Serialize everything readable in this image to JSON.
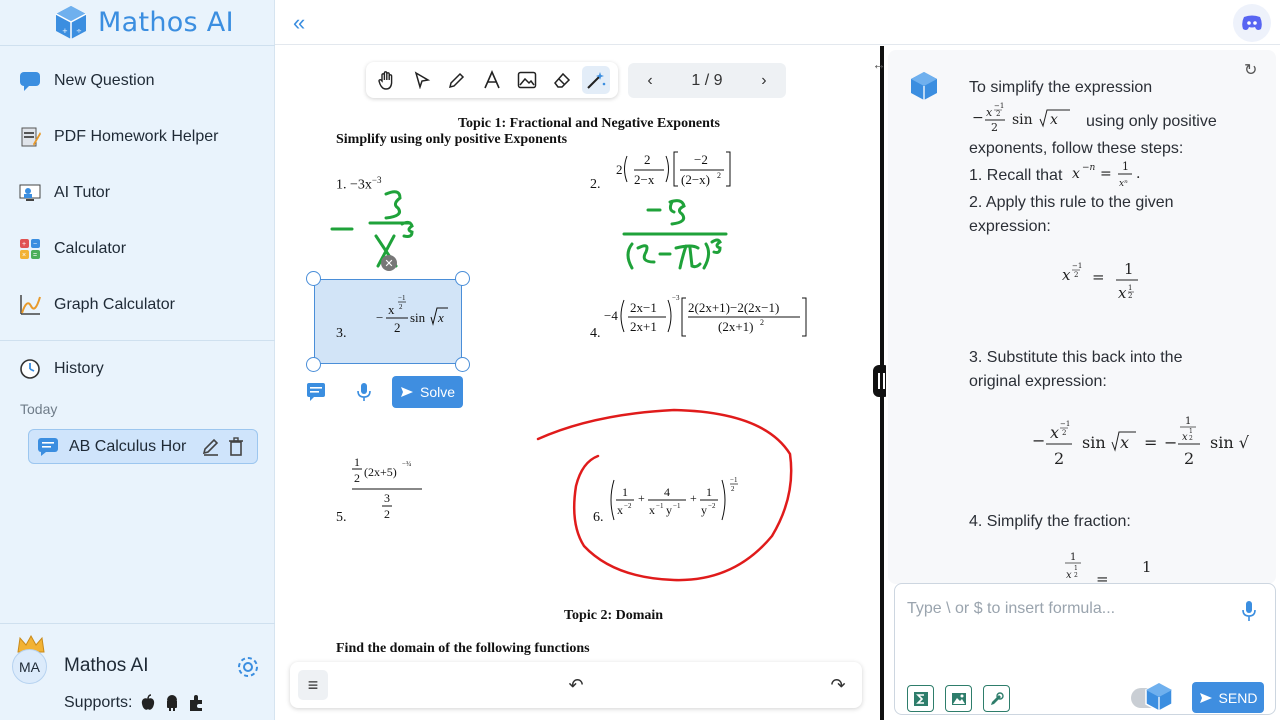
{
  "app": {
    "title": "Mathos AI"
  },
  "sidebar": {
    "items": [
      {
        "label": "New Question",
        "icon": "chat-bubble-icon"
      },
      {
        "label": "PDF Homework Helper",
        "icon": "pdf-icon"
      },
      {
        "label": "AI Tutor",
        "icon": "tutor-icon"
      },
      {
        "label": "Calculator",
        "icon": "calculator-icon"
      },
      {
        "label": "Graph Calculator",
        "icon": "graph-icon"
      }
    ],
    "history_label": "History",
    "today_label": "Today",
    "history_items": [
      {
        "label": "AB Calculus Hor"
      }
    ]
  },
  "user": {
    "initials": "MA",
    "name": "Mathos AI",
    "supports_label": "Supports:"
  },
  "document": {
    "pager": {
      "current": "1 / 9"
    },
    "topic1_title": "Topic 1: Fractional and Negative Exponents",
    "topic1_subtitle": "Simplify using only positive Exponents",
    "problems": [
      {
        "num": "1.",
        "text": "−3x",
        "exp": "−3"
      },
      {
        "num": "2."
      },
      {
        "num": "3."
      },
      {
        "num": "4."
      },
      {
        "num": "5."
      },
      {
        "num": "6."
      }
    ],
    "solve_label": "Solve",
    "topic2_title": "Topic 2: Domain",
    "topic2_subtitle": "Find the domain of the following functions"
  },
  "chat": {
    "messages": [
      "To simplify the expression",
      "using only positive",
      "exponents, follow these steps:",
      "1. Recall that",
      "2. Apply this rule to the given",
      "expression:",
      "3. Substitute this back into the",
      "original expression:",
      "4. Simplify the fraction:"
    ],
    "input_placeholder": "Type \\ or $ to insert formula...",
    "send_label": "SEND"
  },
  "colors": {
    "accent": "#3f8ee0",
    "sidebar_bg": "#e9f3fc",
    "ink_green": "#1fa23a",
    "ink_red": "#e01b1b"
  }
}
